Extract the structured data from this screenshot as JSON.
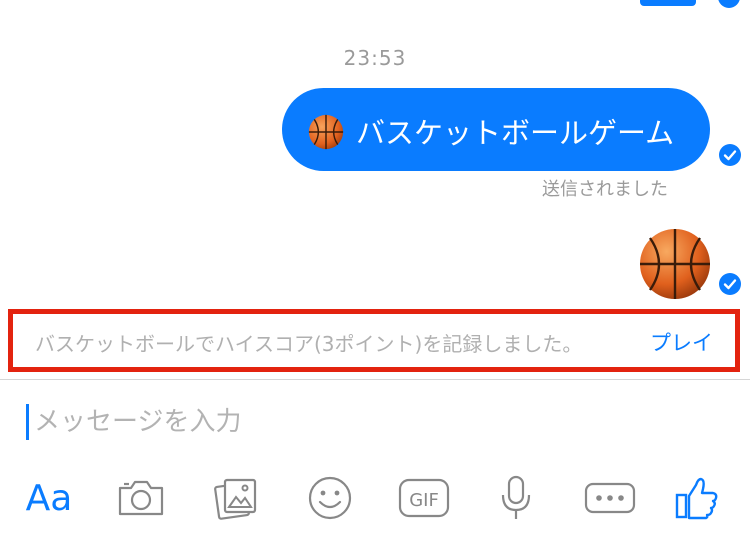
{
  "thread": {
    "timestamp": "23:53",
    "message_text": "バスケットボールゲーム",
    "sent_status": "送信されました",
    "game_notice": {
      "text": "バスケットボールでハイスコア(3ポイント)を記録しました。",
      "action_label": "プレイ"
    }
  },
  "composer": {
    "placeholder": "メッセージを入力",
    "font_button_label": "Aa",
    "gif_label": "GIF",
    "icons": [
      "camera-icon",
      "gallery-icon",
      "emoji-icon",
      "gif-icon",
      "microphone-icon",
      "more-icon",
      "thumbs-up-icon"
    ]
  },
  "colors": {
    "accent": "#0a7cff",
    "highlight_border": "#e3230f",
    "muted_text": "#9a9a9a",
    "basketball": "#e8702a"
  }
}
